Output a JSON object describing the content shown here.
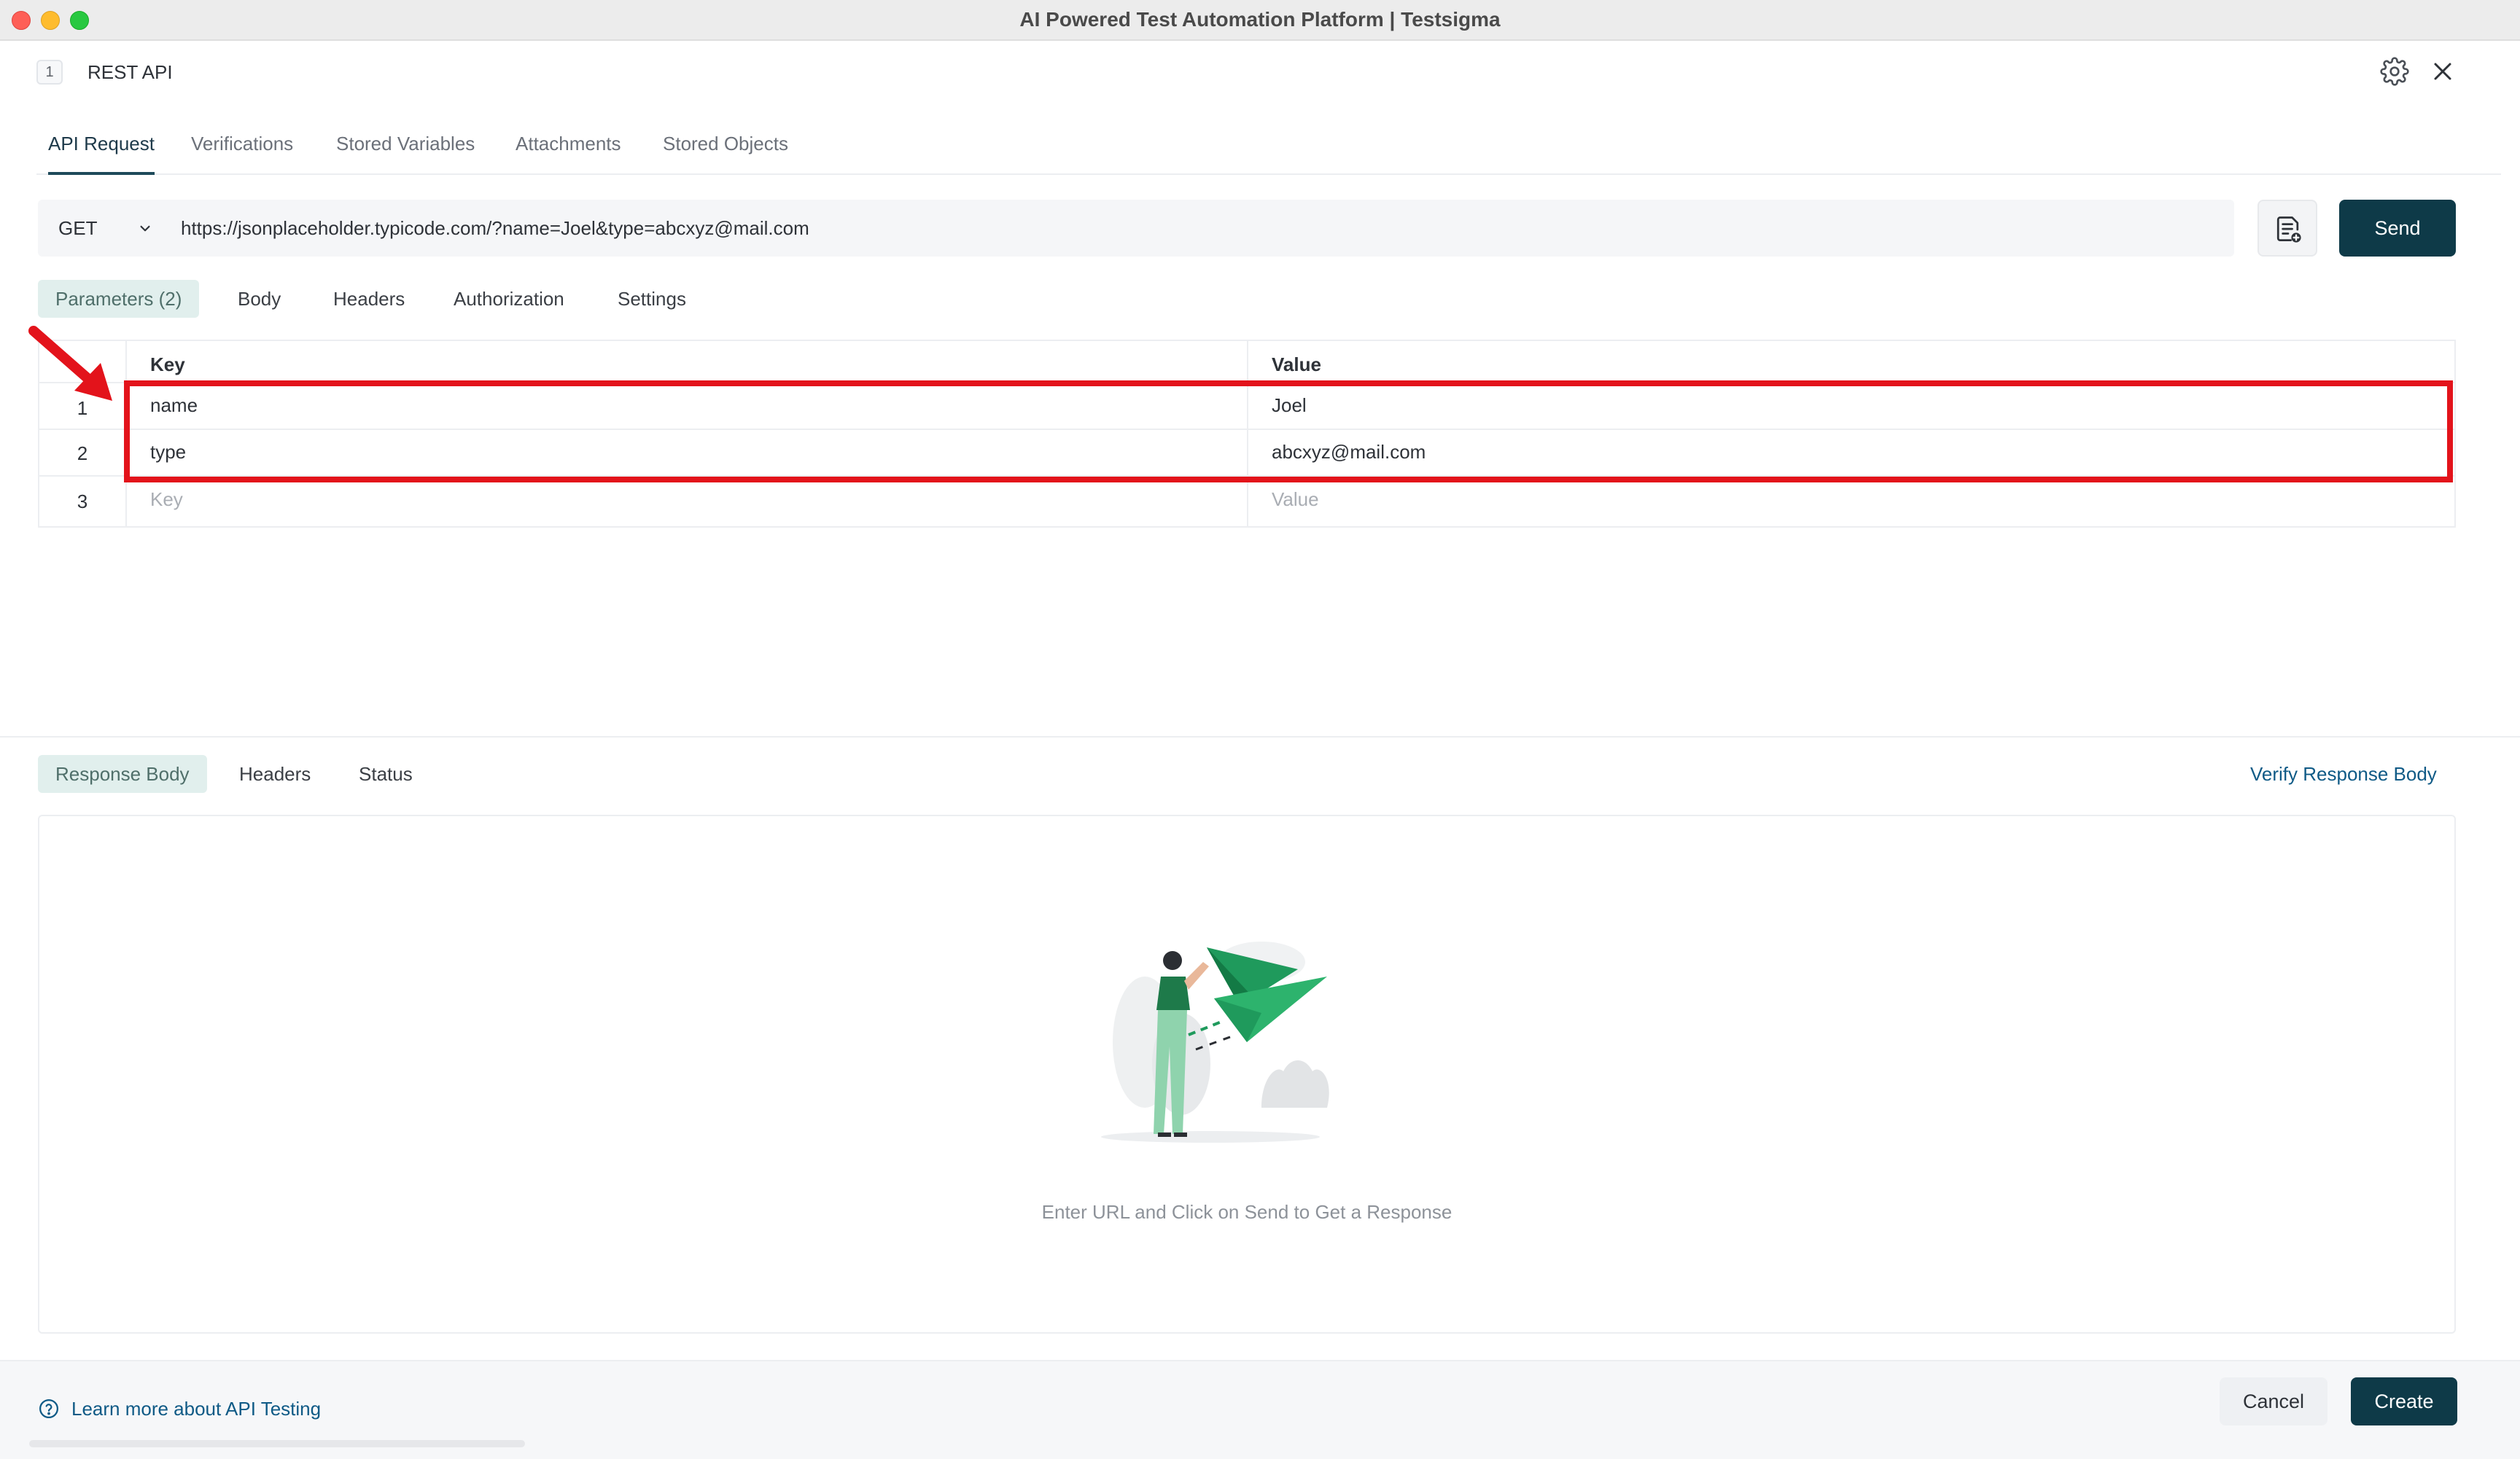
{
  "window": {
    "title": "AI Powered Test Automation Platform | Testsigma"
  },
  "dialog": {
    "step_number": "1",
    "title": "REST API"
  },
  "main_tabs": [
    {
      "label": "API Request",
      "active": true
    },
    {
      "label": "Verifications",
      "active": false
    },
    {
      "label": "Stored Variables",
      "active": false
    },
    {
      "label": "Attachments",
      "active": false
    },
    {
      "label": "Stored Objects",
      "active": false
    }
  ],
  "request": {
    "method": "GET",
    "url": "https://jsonplaceholder.typicode.com/?name=Joel&type=abcxyz@mail.com",
    "send_label": "Send"
  },
  "sub_tabs": [
    {
      "label": "Parameters (2)",
      "active": true
    },
    {
      "label": "Body",
      "active": false
    },
    {
      "label": "Headers",
      "active": false
    },
    {
      "label": "Authorization",
      "active": false
    },
    {
      "label": "Settings",
      "active": false
    }
  ],
  "params": {
    "key_header": "Key",
    "value_header": "Value",
    "rows": [
      {
        "num": "1",
        "key": "name",
        "value": "Joel"
      },
      {
        "num": "2",
        "key": "type",
        "value": "abcxyz@mail.com"
      }
    ],
    "empty_row": {
      "num": "3",
      "key_placeholder": "Key",
      "value_placeholder": "Value"
    }
  },
  "response": {
    "tabs": [
      {
        "label": "Response Body",
        "active": true
      },
      {
        "label": "Headers",
        "active": false
      },
      {
        "label": "Status",
        "active": false
      }
    ],
    "verify_link": "Verify Response Body",
    "empty_message": "Enter URL and Click on Send to Get a Response"
  },
  "footer": {
    "learn_more": "Learn more about API Testing",
    "cancel_label": "Cancel",
    "create_label": "Create"
  },
  "colors": {
    "primary": "#0e3a48",
    "link": "#0f5a86",
    "highlight": "#e3131b",
    "active_tab_bg": "#e1efed",
    "illustration_green": "#1f9a5c"
  },
  "icons": {
    "gear": "gear-icon",
    "close": "close-icon",
    "method_dropdown": "chevron-down-icon",
    "save_request": "document-add-icon",
    "help": "help-circle-icon"
  }
}
